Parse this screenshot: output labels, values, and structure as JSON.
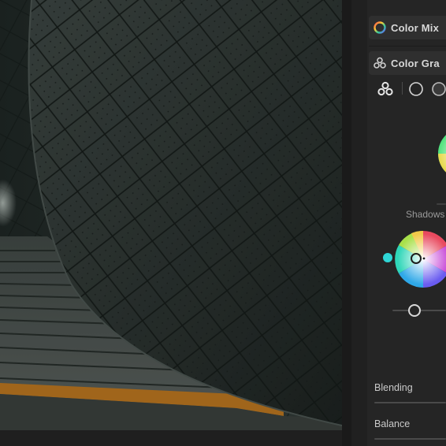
{
  "panel": {
    "color_mixer": {
      "title": "Color Mix",
      "icon": "color-wheel-icon"
    },
    "color_grading": {
      "title": "Color Gra",
      "icon": "three-circles-icon",
      "view_modes": [
        "three-circles-icon",
        "circle-icon",
        "filled-circle-icon"
      ],
      "wheel_label": "Shadows",
      "blending_label": "Blending",
      "balance_label": "Balance"
    }
  },
  "colors": {
    "panel_bg": "#252525",
    "header_bg": "#2f2f2f",
    "accent_cyan": "#2fd6d6",
    "text": "#d8d8d8"
  }
}
